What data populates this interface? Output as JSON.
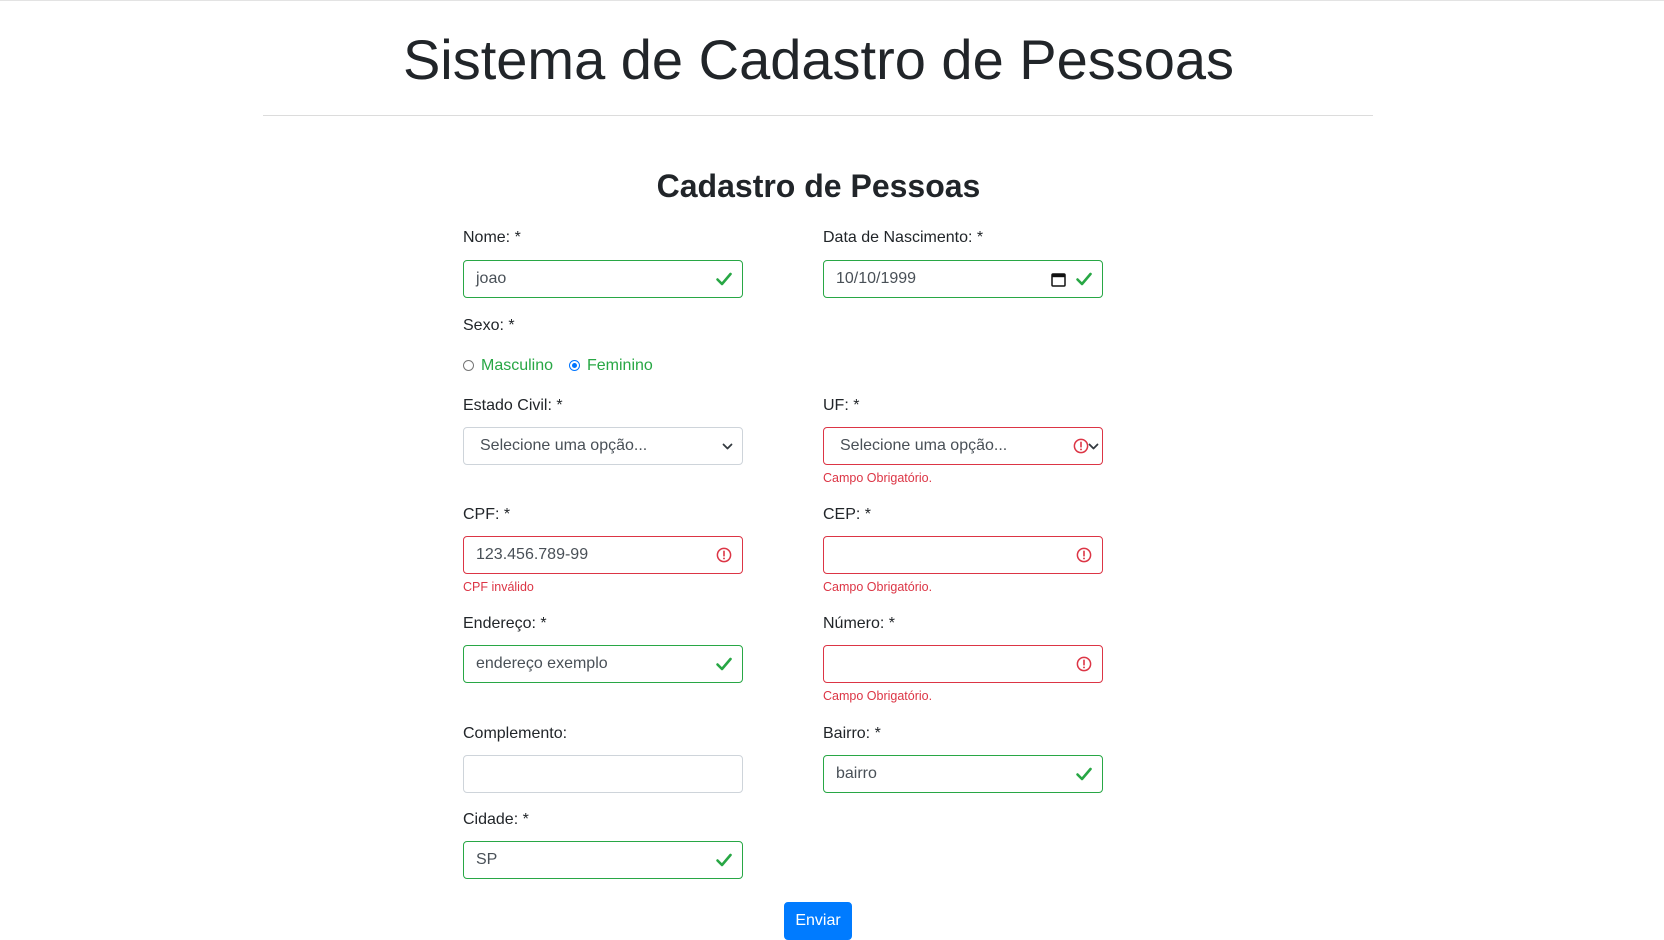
{
  "header": {
    "title": "Sistema de Cadastro de Pessoas"
  },
  "form": {
    "title": "Cadastro de Pessoas",
    "nome": {
      "label": "Nome: *",
      "value": "joao",
      "status": "valid"
    },
    "nascimento": {
      "label": "Data de Nascimento: *",
      "value": "10/10/1999",
      "status": "valid"
    },
    "sexo": {
      "label": "Sexo: *",
      "options": [
        {
          "label": "Masculino",
          "checked": false
        },
        {
          "label": "Feminino",
          "checked": true
        }
      ]
    },
    "estado_civil": {
      "label": "Estado Civil: *",
      "selected": "Selecione uma opção..."
    },
    "uf": {
      "label": "UF: *",
      "selected": "Selecione uma opção...",
      "status": "invalid",
      "feedback": "Campo Obrigatório."
    },
    "cpf": {
      "label": "CPF: *",
      "value": "123.456.789-99",
      "status": "invalid",
      "feedback": "CPF inválido"
    },
    "cep": {
      "label": "CEP: *",
      "value": "",
      "status": "invalid",
      "feedback": "Campo Obrigatório."
    },
    "endereco": {
      "label": "Endereço: *",
      "value": "endereço exemplo",
      "status": "valid"
    },
    "numero": {
      "label": "Número: *",
      "value": "",
      "status": "invalid",
      "feedback": "Campo Obrigatório."
    },
    "complemento": {
      "label": "Complemento:",
      "value": ""
    },
    "bairro": {
      "label": "Bairro: *",
      "value": "bairro",
      "status": "valid"
    },
    "cidade": {
      "label": "Cidade: *",
      "value": "SP",
      "status": "valid"
    },
    "submit_label": "Enviar"
  },
  "colors": {
    "valid": "#28a745",
    "invalid": "#dc3545",
    "primary": "#007bff",
    "radio_checked": "#0075ff"
  },
  "icons": {
    "valid": "check-icon",
    "invalid": "exclamation-circle-icon",
    "date": "calendar-icon",
    "select": "chevron-down-icon"
  }
}
